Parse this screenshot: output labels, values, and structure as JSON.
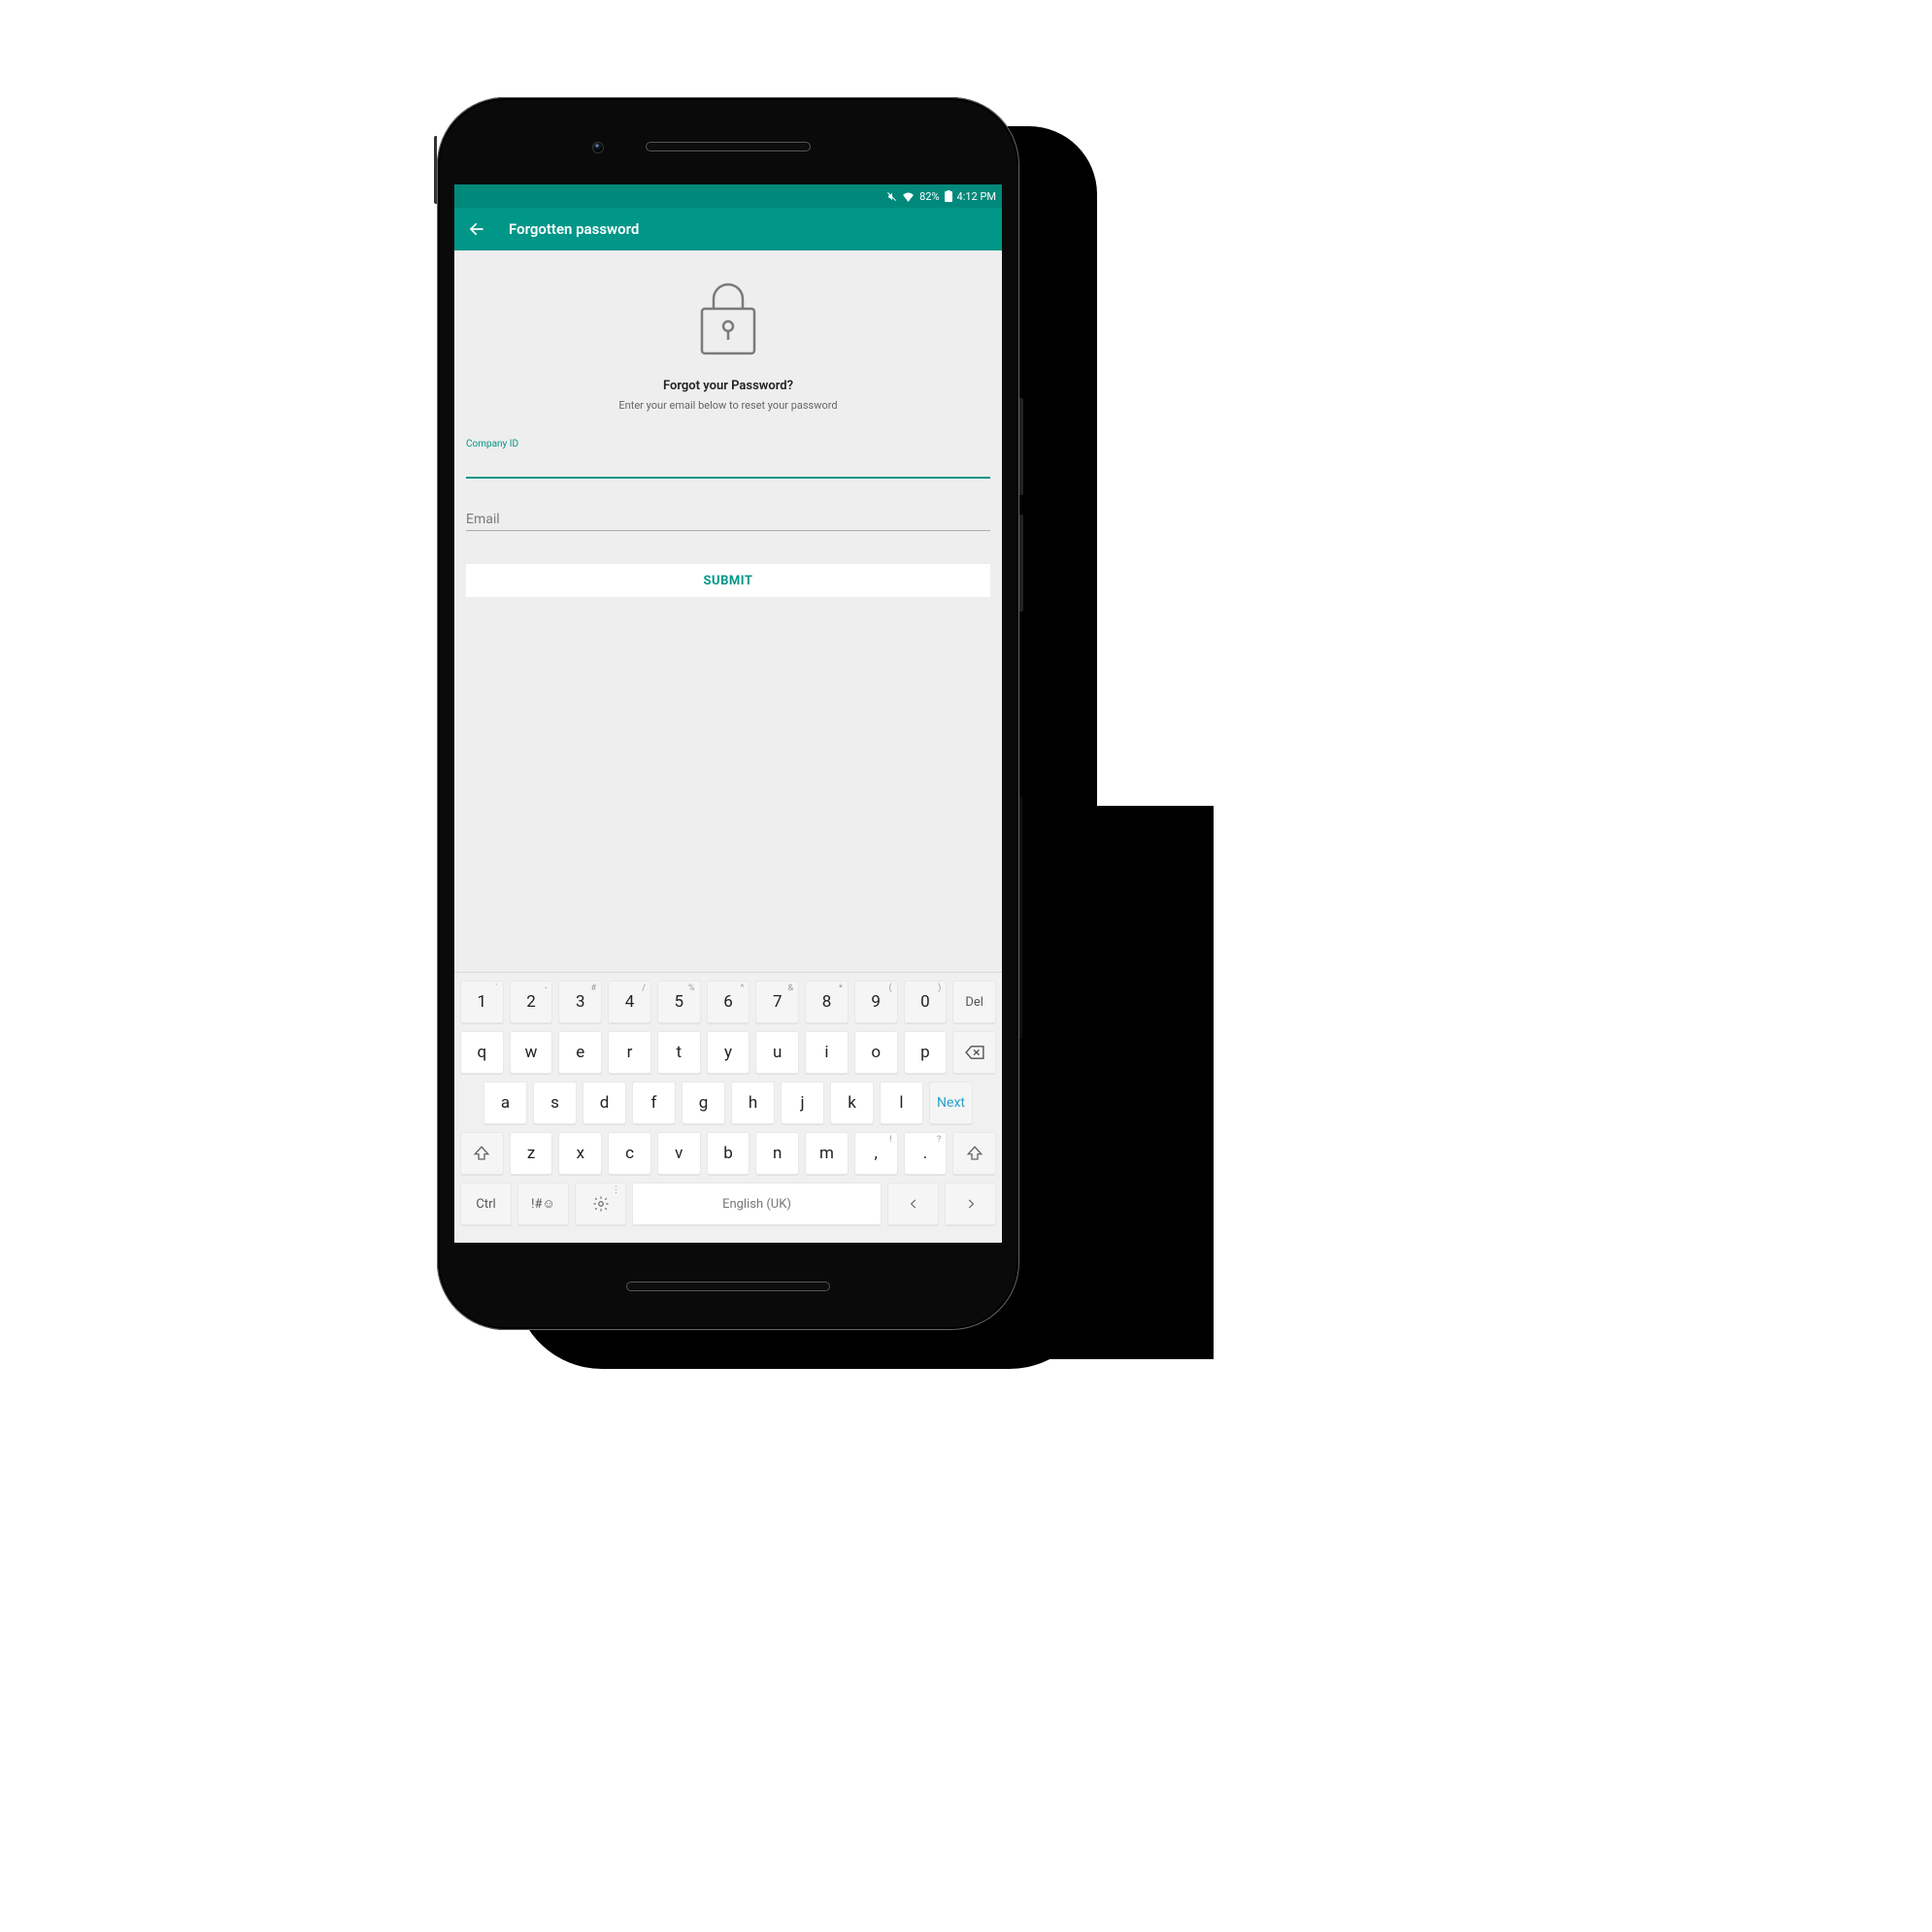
{
  "status": {
    "battery_pct": "82%",
    "time": "4:12 PM"
  },
  "appbar": {
    "title": "Forgotten password"
  },
  "main": {
    "headline": "Forgot your Password?",
    "subline": "Enter your email below to reset your password",
    "company_label": "Company ID",
    "company_value": "",
    "email_placeholder": "Email",
    "email_value": "",
    "submit_label": "SUBMIT"
  },
  "keyboard": {
    "row1": [
      {
        "k": "1",
        "s": "`"
      },
      {
        "k": "2",
        "s": "-"
      },
      {
        "k": "3",
        "s": "#"
      },
      {
        "k": "4",
        "s": "/"
      },
      {
        "k": "5",
        "s": "%"
      },
      {
        "k": "6",
        "s": "^"
      },
      {
        "k": "7",
        "s": "&"
      },
      {
        "k": "8",
        "s": "*"
      },
      {
        "k": "9",
        "s": "("
      },
      {
        "k": "0",
        "s": ")"
      }
    ],
    "del": "Del",
    "row2": [
      "q",
      "w",
      "e",
      "r",
      "t",
      "y",
      "u",
      "i",
      "o",
      "p"
    ],
    "row3": [
      "a",
      "s",
      "d",
      "f",
      "g",
      "h",
      "j",
      "k",
      "l"
    ],
    "next": "Next",
    "row4": [
      "z",
      "x",
      "c",
      "v",
      "b",
      "n",
      "m"
    ],
    "punct1": {
      "k": ",",
      "s": "!"
    },
    "punct2": {
      "k": ".",
      "s": "?"
    },
    "row5": {
      "ctrl": "Ctrl",
      "sym": "!#☺",
      "space": "English (UK)"
    }
  }
}
